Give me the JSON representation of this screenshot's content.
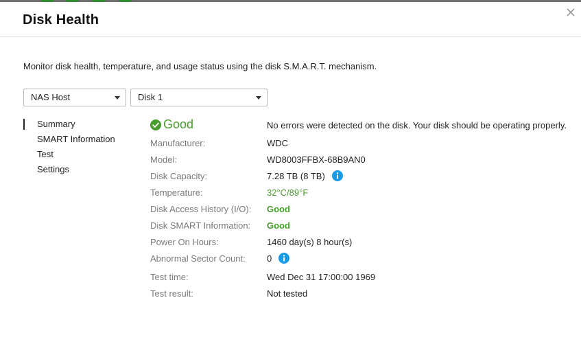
{
  "header": {
    "title": "Disk Health",
    "close_icon": "close-icon"
  },
  "description": "Monitor disk health, temperature, and usage status using the disk S.M.A.R.T. mechanism.",
  "selectors": {
    "host": "NAS Host",
    "disk": "Disk 1"
  },
  "nav": [
    {
      "label": "Summary",
      "active": true
    },
    {
      "label": "SMART Information",
      "active": false
    },
    {
      "label": "Test",
      "active": false
    },
    {
      "label": "Settings",
      "active": false
    }
  ],
  "summary": {
    "status": "Good",
    "status_icon": "check-circle-icon",
    "status_message": "No errors were detected on the disk. Your disk should be operating properly.",
    "rows": [
      {
        "label": "Manufacturer:",
        "value": "WDC"
      },
      {
        "label": "Model:",
        "value": "WD8003FFBX-68B9AN0"
      },
      {
        "label": "Disk Capacity:",
        "value": "7.28 TB (8 TB)",
        "info_icon": true
      },
      {
        "label": "Temperature:",
        "value": "32°C/89°F"
      },
      {
        "label": "Disk Access History (I/O):",
        "value": "Good"
      },
      {
        "label": "Disk SMART Information:",
        "value": "Good"
      },
      {
        "label": "Power On Hours:",
        "value": "1460 day(s) 8 hour(s)"
      },
      {
        "label": "Abnormal Sector Count:",
        "value": "0",
        "info_icon": true
      },
      {
        "label": "Test time:",
        "value": "Wed Dec 31 17:00:00 1969"
      },
      {
        "label": "Test result:",
        "value": "Not tested"
      }
    ]
  },
  "colors": {
    "good": "#4a9c2e",
    "info": "#1a9be6",
    "label": "#7a7a7a"
  }
}
